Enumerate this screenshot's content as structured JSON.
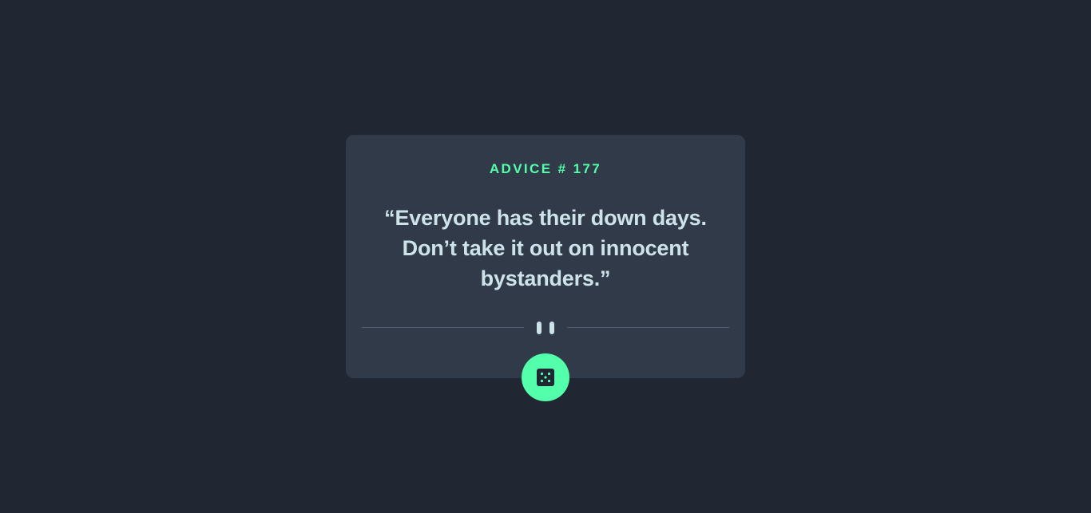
{
  "advice": {
    "id_label": "ADVICE # 177",
    "quote": "“Everyone has their down days. Don’t take it out on innocent bystanders.”"
  },
  "divider": {
    "icon": "pause-icon"
  },
  "button": {
    "icon": "dice-icon",
    "color": "#53ffaa"
  },
  "colors": {
    "background": "#202632",
    "card": "#313a48",
    "accent": "#53ffaa",
    "text": "#cee3e9"
  }
}
